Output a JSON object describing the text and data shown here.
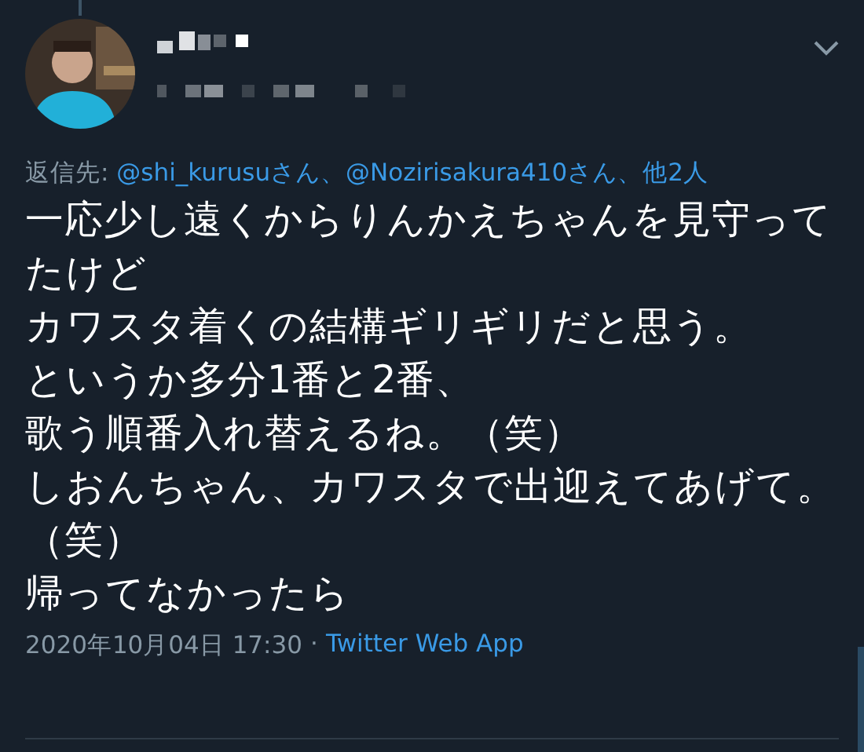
{
  "tweet": {
    "reply": {
      "label": "返信先:",
      "separator": "、",
      "links": [
        "@shi_kurusuさん",
        "@Nozirisakura410さん",
        "他2人"
      ]
    },
    "body_lines": [
      "一応少し遠くからりんかえちゃんを見守って",
      "たけど",
      "カワスタ着くの結構ギリギリだと思う。",
      "というか多分1番と2番、",
      "歌う順番入れ替えるね。（笑）",
      "しおんちゃん、カワスタで出迎えてあげて。",
      "（笑）",
      "帰ってなかったら"
    ],
    "timestamp": "2020年10月04日 17:30",
    "dot": "·",
    "source": "Twitter Web App"
  }
}
